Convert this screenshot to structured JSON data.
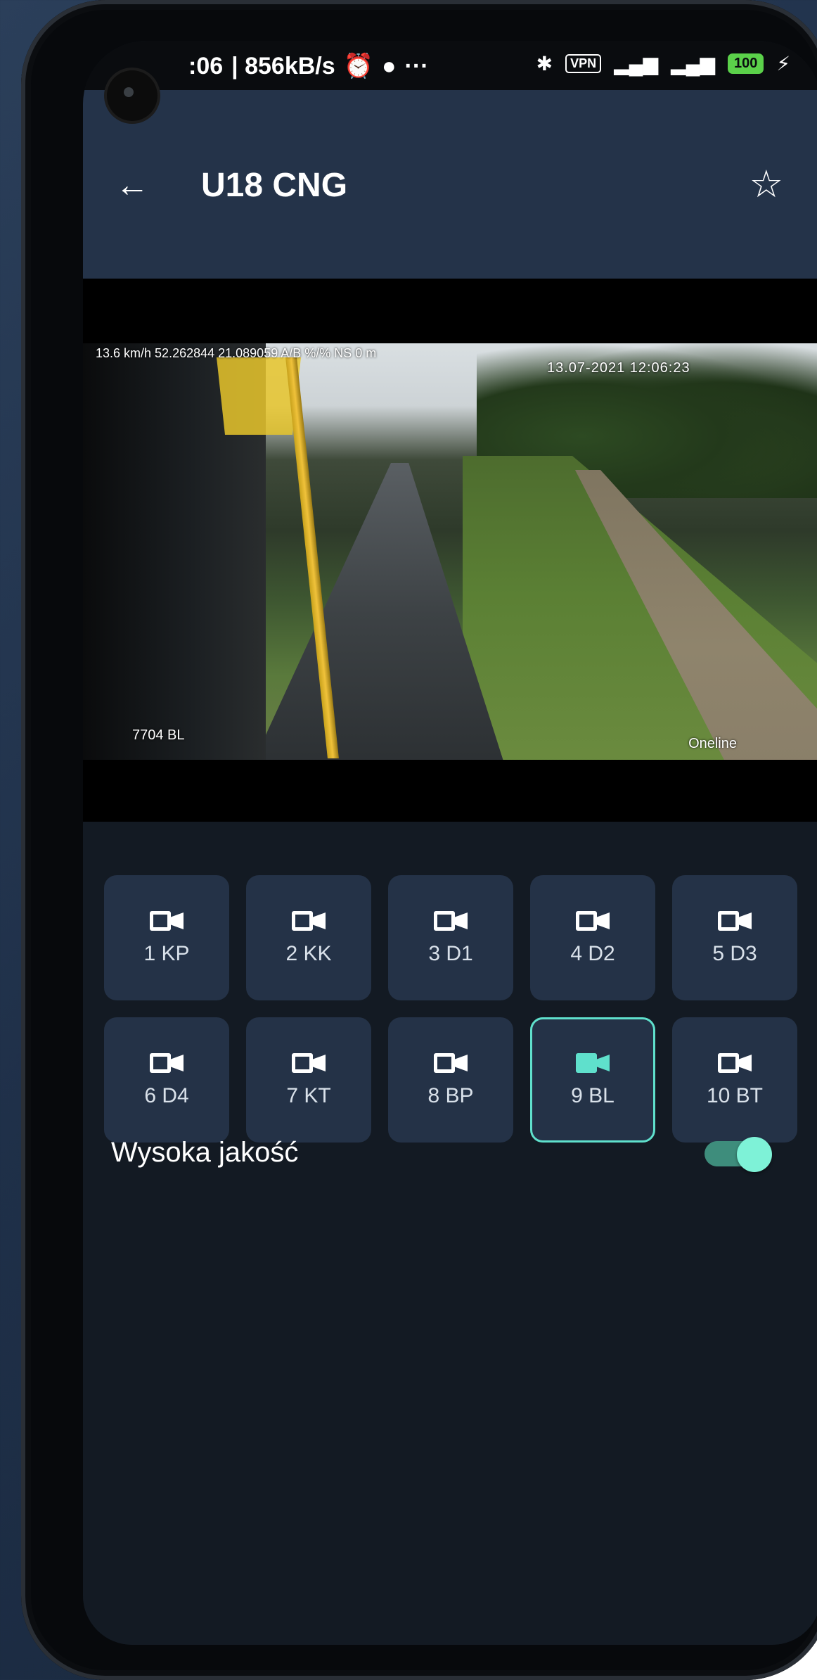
{
  "status_bar": {
    "time": ":06",
    "speed": "| 856kB/s",
    "vpn": "VPN",
    "battery": "100"
  },
  "header": {
    "title": "U18 CNG"
  },
  "video": {
    "telemetry": "13.6 km/h 52.262844 21.089059 A/B %/% NS     0 m",
    "datetime": "13.07-2021 12:06:23",
    "camera_label": "7704 BL",
    "brand": "Oneline"
  },
  "cameras": [
    {
      "label": "1 KP",
      "selected": false
    },
    {
      "label": "2 KK",
      "selected": false
    },
    {
      "label": "3 D1",
      "selected": false
    },
    {
      "label": "4 D2",
      "selected": false
    },
    {
      "label": "5 D3",
      "selected": false
    },
    {
      "label": "6 D4",
      "selected": false
    },
    {
      "label": "7 KT",
      "selected": false
    },
    {
      "label": "8 BP",
      "selected": false
    },
    {
      "label": "9 BL",
      "selected": true
    },
    {
      "label": "10 BT",
      "selected": false
    }
  ],
  "settings": {
    "high_quality_label": "Wysoka jakość",
    "high_quality_on": true
  },
  "colors": {
    "accent": "#5fe0cc",
    "appbar": "#243349",
    "button_bg": "#243247",
    "screen_bg": "#131a23"
  }
}
